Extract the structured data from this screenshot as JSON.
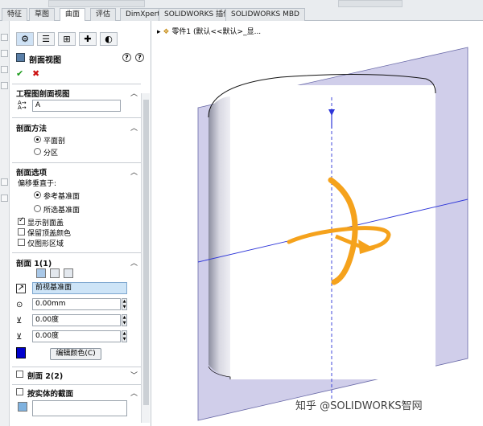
{
  "tabs": [
    "特征",
    "草图",
    "曲面",
    "评估",
    "DimXpert",
    "SOLIDWORKS 插件",
    "SOLIDWORKS MBD"
  ],
  "active_tab": "曲面",
  "panel": {
    "title": "剖面视图",
    "help_label": "?",
    "ok_label": "✔",
    "cancel_label": "✖",
    "section_label_title": "工程图剖面视图",
    "section_label_value": "A",
    "method_title": "剖面方法",
    "method_options": [
      "平面剖",
      "分区"
    ],
    "options_title": "剖面选项",
    "offset_label": "偏移垂直于:",
    "offset_options": [
      "参考基准面",
      "所选基准面"
    ],
    "check_show_cap": "显示剖面盖",
    "check_keep_color": "保留顶盖颜色",
    "check_graphics_only": "仅图形区域",
    "section1_title": "剖面 1(1)",
    "plane_value": "前视基准面",
    "offset_value": "0.00mm",
    "angle_x_value": "0.00度",
    "angle_y_value": "0.00度",
    "edit_color_label": "编辑颜色(C)",
    "cap_color": "#0000cc",
    "section2_title": "剖面 2(2)",
    "by_body_title": "按实体的截面"
  },
  "viewport": {
    "tree_label": "零件1  (默认<<默认>_显...",
    "watermark": "知乎 @SOLIDWORKS智网"
  },
  "colors": {
    "plane_fill": "#c8c6e6",
    "plane_edge": "#6a6aa8",
    "axis_blue": "#2d35d8",
    "triad_orange": "#f5a21c"
  }
}
